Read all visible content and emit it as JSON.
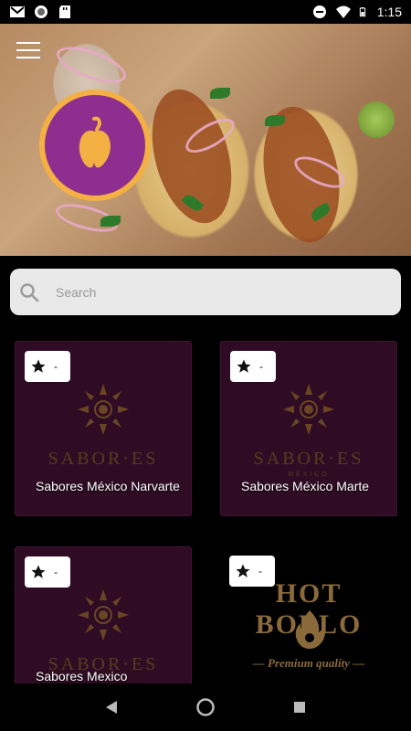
{
  "status_bar": {
    "time": "1:15",
    "left_icons": [
      "gmail-icon",
      "record-icon",
      "sd-card-icon"
    ],
    "right_icons": [
      "do-not-disturb-icon",
      "wifi-icon",
      "battery-icon"
    ]
  },
  "header": {
    "menu_icon": "menu-icon",
    "logo_icon": "pepper-icon",
    "colors": {
      "logo_ring": "#f5b043",
      "logo_fill": "#8e2e8e"
    }
  },
  "search": {
    "placeholder": "Search",
    "value": ""
  },
  "restaurants": [
    {
      "name": "Sabores México Narvarte",
      "rating": "-",
      "brand_word": "SABOR·ES",
      "brand_sub": ""
    },
    {
      "name": "Sabores México Marte",
      "rating": "-",
      "brand_word": "SABOR·ES",
      "brand_sub": "MÉXICO"
    },
    {
      "name": "Sabores Mexico",
      "rating": "-",
      "brand_word": "SABOR·ES",
      "brand_sub": ""
    },
    {
      "name": "",
      "rating": "-",
      "brand_word": "HOT BOLLO",
      "brand_sub": "— Premium quality —"
    }
  ],
  "colors": {
    "card_bg": "#2f0c24",
    "brand_gold": "#5a3a1e"
  },
  "nav": {
    "icons": [
      "back-icon",
      "home-icon",
      "recents-icon"
    ]
  }
}
